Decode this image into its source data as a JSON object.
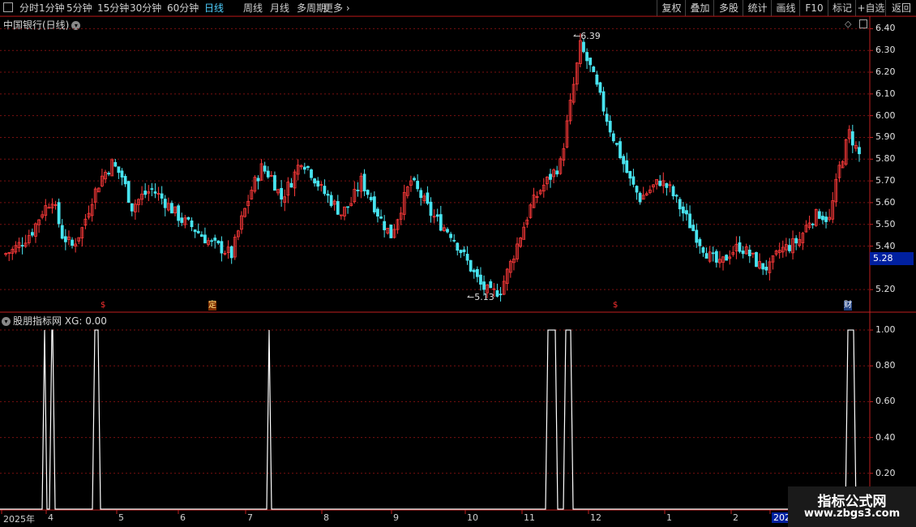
{
  "toolbar": {
    "periods": [
      "分时",
      "1分钟",
      "5分钟",
      "15分钟",
      "30分钟",
      "60分钟",
      "日线",
      "周线",
      "月线",
      "多周期",
      "更多"
    ],
    "active_period": "日线",
    "more_arrow": "›",
    "right_buttons": [
      "复权",
      "叠加",
      "多股",
      "统计",
      "画线",
      "F10",
      "标记",
      "+自选",
      "返回"
    ]
  },
  "main_panel": {
    "title": "中国银行(日线)",
    "current_price_tag": "5.28",
    "high_annotation": "6.39",
    "low_annotation": "5.13",
    "event_markers": [
      {
        "label": "$",
        "color": "#ff3030"
      },
      {
        "label": "定",
        "color": "#ffd040"
      },
      {
        "label": "$",
        "color": "#ff3030"
      },
      {
        "label": "财",
        "color": "#80c0ff"
      }
    ]
  },
  "indicator_panel": {
    "title": "股朋指标网",
    "value_text": "XG: 0.00"
  },
  "x_axis": {
    "labels": [
      "2025年",
      "4",
      "5",
      "6",
      "7",
      "8",
      "9",
      "10",
      "11",
      "12",
      "1",
      "2",
      "202"
    ]
  },
  "watermark": {
    "line1": "指标公式网",
    "line2": "www.zbgs3.com"
  },
  "colors": {
    "up": "#ff3a3a",
    "down": "#48e4f0",
    "grid": "#7a1010",
    "indicator_line": "#ffffff",
    "active_tab": "#4fd0ff"
  },
  "chart_data": [
    {
      "type": "candlestick",
      "title": "中国银行(日线)",
      "y_ticks": [
        "6.40",
        "6.30",
        "6.20",
        "6.10",
        "6.00",
        "5.90",
        "5.80",
        "5.70",
        "5.60",
        "5.50",
        "5.40",
        "5.20"
      ],
      "ylim": [
        5.1,
        6.45
      ],
      "marked_high": 6.39,
      "marked_low": 5.13,
      "close_series_approx": [
        5.36,
        5.38,
        5.42,
        5.47,
        5.56,
        5.62,
        5.45,
        5.4,
        5.48,
        5.62,
        5.72,
        5.78,
        5.72,
        5.58,
        5.63,
        5.66,
        5.62,
        5.57,
        5.52,
        5.49,
        5.45,
        5.41,
        5.39,
        5.36,
        5.52,
        5.66,
        5.76,
        5.72,
        5.62,
        5.7,
        5.8,
        5.74,
        5.66,
        5.61,
        5.55,
        5.6,
        5.7,
        5.62,
        5.52,
        5.45,
        5.58,
        5.7,
        5.63,
        5.55,
        5.5,
        5.46,
        5.38,
        5.3,
        5.22,
        5.18,
        5.2,
        5.32,
        5.45,
        5.58,
        5.66,
        5.72,
        5.78,
        6.05,
        6.32,
        6.22,
        6.08,
        5.94,
        5.82,
        5.7,
        5.62,
        5.66,
        5.7,
        5.66,
        5.58,
        5.5,
        5.42,
        5.35,
        5.31,
        5.37,
        5.4,
        5.36,
        5.31,
        5.3,
        5.38,
        5.4,
        5.43,
        5.52,
        5.55,
        5.52,
        5.76,
        5.92,
        5.82
      ]
    },
    {
      "type": "line",
      "title": "股朋指标网",
      "series": [
        {
          "name": "XG",
          "values": [
            0,
            1,
            0,
            1,
            0,
            1,
            0,
            1,
            0,
            1,
            1,
            0,
            1
          ]
        }
      ],
      "y_ticks": [
        "1.00",
        "0.80",
        "0.60",
        "0.40",
        "0.20"
      ],
      "ylim": [
        0,
        1.05
      ]
    }
  ]
}
